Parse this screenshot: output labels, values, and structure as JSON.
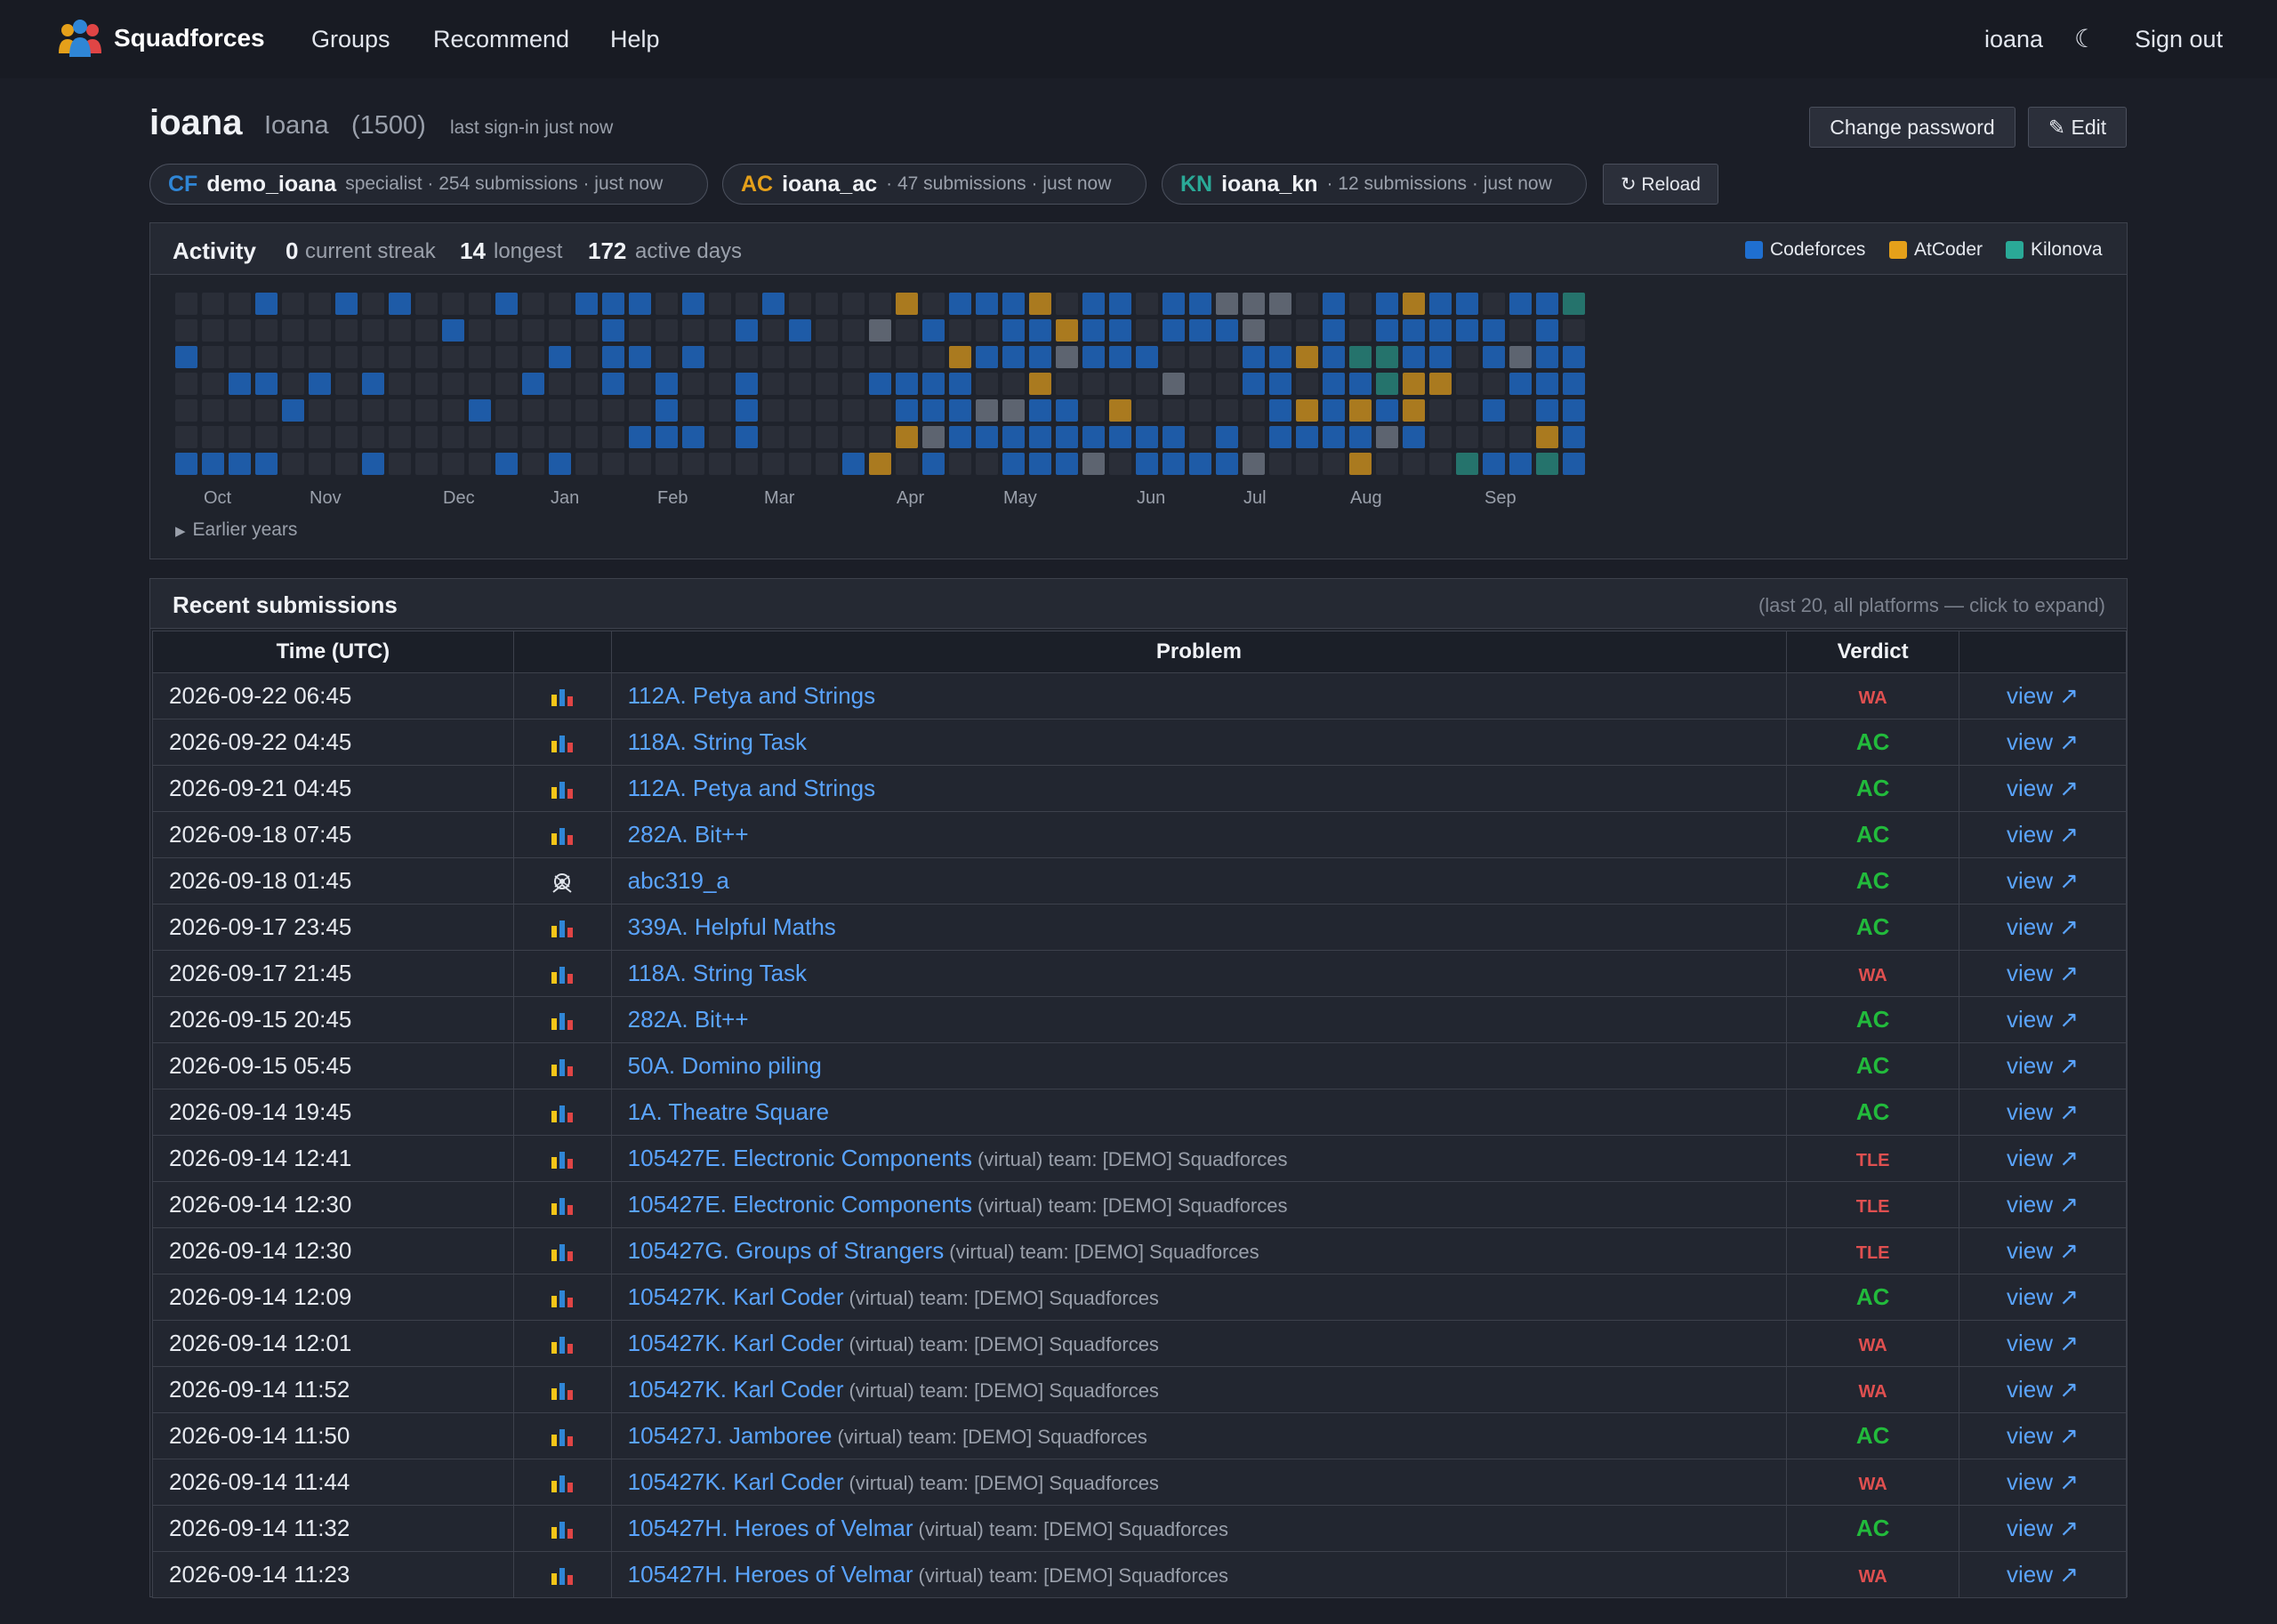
{
  "nav": {
    "brand": "Squadforces",
    "links": [
      "Groups",
      "Recommend",
      "Help"
    ],
    "user": "ioana",
    "theme_toggle": "☾",
    "signout": "Sign out"
  },
  "profile": {
    "username": "ioana",
    "full_name": "Ioana",
    "rating": "(1500)",
    "last_signin": "last sign-in just now",
    "change_password": "Change password",
    "edit": "✎ Edit",
    "reload": "↻ Reload"
  },
  "accounts": [
    {
      "tag": "CF",
      "handle": "demo_ioana",
      "meta": "specialist · 254 submissions · just now",
      "color": "#2f86d6"
    },
    {
      "tag": "AC",
      "handle": "ioana_ac",
      "meta": "· 47 submissions · just now",
      "color": "#e5a01a"
    },
    {
      "tag": "KN",
      "handle": "ioana_kn",
      "meta": "· 12 submissions · just now",
      "color": "#2aa997"
    }
  ],
  "activity": {
    "title": "Activity",
    "current_streak": "0",
    "current_streak_label": "current streak",
    "longest": "14",
    "longest_label": "longest",
    "active_days": "172",
    "active_days_label": "active days",
    "legend": [
      {
        "name": "Codeforces",
        "color": "#1f6fd0"
      },
      {
        "name": "AtCoder",
        "color": "#e5a01a"
      },
      {
        "name": "Kilonova",
        "color": "#2aa997"
      }
    ],
    "months": [
      "Oct",
      "Nov",
      "Dec",
      "Jan",
      "Feb",
      "Mar",
      "Apr",
      "May",
      "Jun",
      "Jul",
      "Aug",
      "Sep"
    ],
    "earlier": "Earlier years"
  },
  "submissions": {
    "title": "Recent submissions",
    "hint": "(last 20, all platforms — click to expand)",
    "headers": [
      "Time (UTC)",
      "",
      "Problem",
      "Verdict",
      ""
    ],
    "view_label": "view ↗",
    "rows": [
      {
        "time": "2026-09-22 06:45",
        "platform": "cf",
        "problem": "112A. Petya and Strings",
        "extra": "",
        "verdict": "WA"
      },
      {
        "time": "2026-09-22 04:45",
        "platform": "cf",
        "problem": "118A. String Task",
        "extra": "",
        "verdict": "AC"
      },
      {
        "time": "2026-09-21 04:45",
        "platform": "cf",
        "problem": "112A. Petya and Strings",
        "extra": "",
        "verdict": "AC"
      },
      {
        "time": "2026-09-18 07:45",
        "platform": "cf",
        "problem": "282A. Bit++",
        "extra": "",
        "verdict": "AC"
      },
      {
        "time": "2026-09-18 01:45",
        "platform": "ac",
        "problem": "abc319_a",
        "extra": "",
        "verdict": "AC"
      },
      {
        "time": "2026-09-17 23:45",
        "platform": "cf",
        "problem": "339A. Helpful Maths",
        "extra": "",
        "verdict": "AC"
      },
      {
        "time": "2026-09-17 21:45",
        "platform": "cf",
        "problem": "118A. String Task",
        "extra": "",
        "verdict": "WA"
      },
      {
        "time": "2026-09-15 20:45",
        "platform": "cf",
        "problem": "282A. Bit++",
        "extra": "",
        "verdict": "AC"
      },
      {
        "time": "2026-09-15 05:45",
        "platform": "cf",
        "problem": "50A. Domino piling",
        "extra": "",
        "verdict": "AC"
      },
      {
        "time": "2026-09-14 19:45",
        "platform": "cf",
        "problem": "1A. Theatre Square",
        "extra": "",
        "verdict": "AC"
      },
      {
        "time": "2026-09-14 12:41",
        "platform": "cf",
        "problem": "105427E. Electronic Components",
        "extra": "(virtual) team: [DEMO] Squadforces",
        "verdict": "TLE"
      },
      {
        "time": "2026-09-14 12:30",
        "platform": "cf",
        "problem": "105427E. Electronic Components",
        "extra": "(virtual) team: [DEMO] Squadforces",
        "verdict": "TLE"
      },
      {
        "time": "2026-09-14 12:30",
        "platform": "cf",
        "problem": "105427G. Groups of Strangers",
        "extra": "(virtual) team: [DEMO] Squadforces",
        "verdict": "TLE"
      },
      {
        "time": "2026-09-14 12:09",
        "platform": "cf",
        "problem": "105427K. Karl Coder",
        "extra": "(virtual) team: [DEMO] Squadforces",
        "verdict": "AC"
      },
      {
        "time": "2026-09-14 12:01",
        "platform": "cf",
        "problem": "105427K. Karl Coder",
        "extra": "(virtual) team: [DEMO] Squadforces",
        "verdict": "WA"
      },
      {
        "time": "2026-09-14 11:52",
        "platform": "cf",
        "problem": "105427K. Karl Coder",
        "extra": "(virtual) team: [DEMO] Squadforces",
        "verdict": "WA"
      },
      {
        "time": "2026-09-14 11:50",
        "platform": "cf",
        "problem": "105427J. Jamboree",
        "extra": "(virtual) team: [DEMO] Squadforces",
        "verdict": "AC"
      },
      {
        "time": "2026-09-14 11:44",
        "platform": "cf",
        "problem": "105427K. Karl Coder",
        "extra": "(virtual) team: [DEMO] Squadforces",
        "verdict": "WA"
      },
      {
        "time": "2026-09-14 11:32",
        "platform": "cf",
        "problem": "105427H. Heroes of Velmar",
        "extra": "(virtual) team: [DEMO] Squadforces",
        "verdict": "AC"
      },
      {
        "time": "2026-09-14 11:23",
        "platform": "cf",
        "problem": "105427H. Heroes of Velmar",
        "extra": "(virtual) team: [DEMO] Squadforces",
        "verdict": "WA"
      }
    ]
  }
}
